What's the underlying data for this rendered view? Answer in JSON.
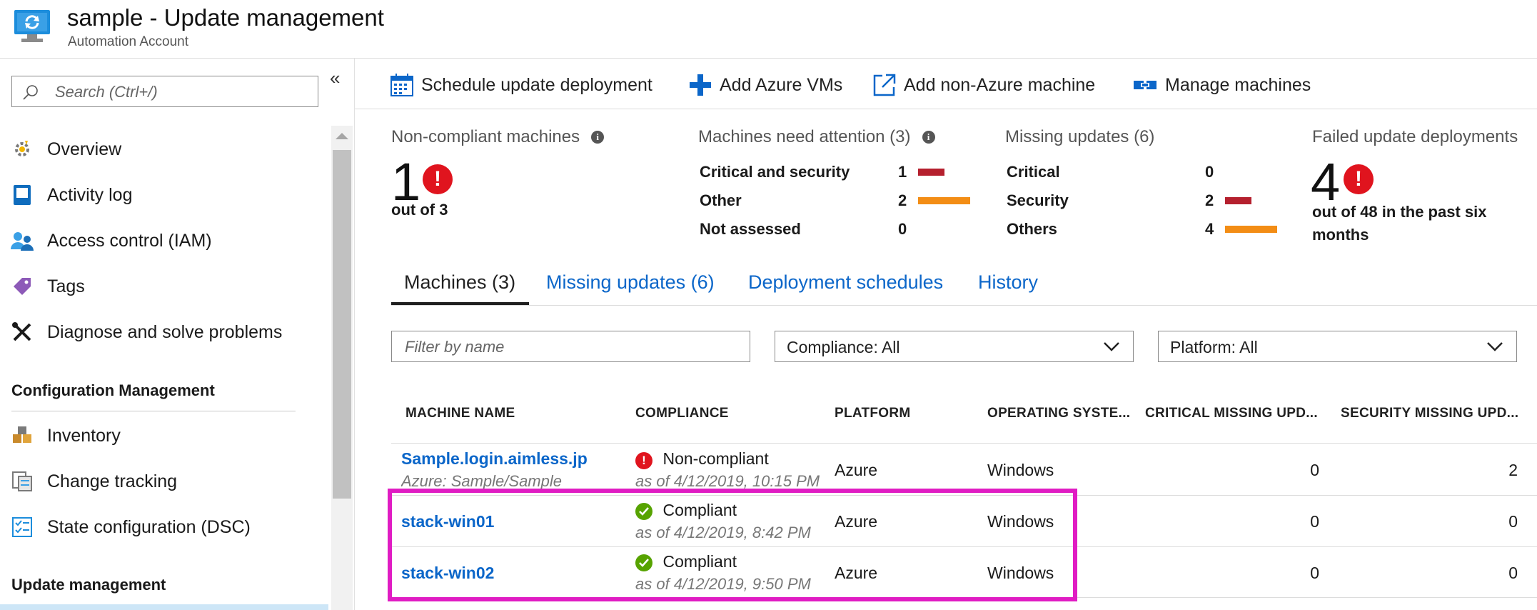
{
  "header": {
    "title": "sample - Update management",
    "subtitle": "Automation Account",
    "icon": "automation-account-icon"
  },
  "sidebar": {
    "search_placeholder": "Search (Ctrl+/)",
    "collapse_glyph": "«",
    "items": [
      {
        "label": "Overview",
        "icon": "overview-icon"
      },
      {
        "label": "Activity log",
        "icon": "activity-log-icon"
      },
      {
        "label": "Access control (IAM)",
        "icon": "iam-icon"
      },
      {
        "label": "Tags",
        "icon": "tag-icon"
      },
      {
        "label": "Diagnose and solve problems",
        "icon": "wrench-icon"
      }
    ],
    "sections": [
      {
        "title": "Configuration Management",
        "items": [
          {
            "label": "Inventory",
            "icon": "inventory-icon"
          },
          {
            "label": "Change tracking",
            "icon": "change-tracking-icon"
          },
          {
            "label": "State configuration (DSC)",
            "icon": "dsc-icon"
          }
        ]
      },
      {
        "title": "Update management",
        "items": []
      }
    ]
  },
  "toolbar": {
    "schedule": "Schedule update deployment",
    "add_azure": "Add Azure VMs",
    "add_non_azure": "Add non-Azure machine",
    "manage": "Manage machines"
  },
  "summary": {
    "noncompliant": {
      "title": "Non-compliant machines",
      "value": "1",
      "caption": "out of 3"
    },
    "attention": {
      "title": "Machines need attention (3)",
      "rows": [
        {
          "label": "Critical and security",
          "value": "1",
          "bar": "red",
          "bar_fraction": 0.5
        },
        {
          "label": "Other",
          "value": "2",
          "bar": "orange",
          "bar_fraction": 1.0
        },
        {
          "label": "Not assessed",
          "value": "0",
          "bar": "none",
          "bar_fraction": 0
        }
      ]
    },
    "missing": {
      "title": "Missing updates (6)",
      "rows": [
        {
          "label": "Critical",
          "value": "0",
          "bar": "none",
          "bar_fraction": 0
        },
        {
          "label": "Security",
          "value": "2",
          "bar": "red",
          "bar_fraction": 0.5
        },
        {
          "label": "Others",
          "value": "4",
          "bar": "orange",
          "bar_fraction": 1.0
        }
      ]
    },
    "failed": {
      "title": "Failed update deployments",
      "value": "4",
      "caption": "out of 48 in the past six months"
    }
  },
  "tabs": [
    "Machines (3)",
    "Missing updates (6)",
    "Deployment schedules",
    "History"
  ],
  "filters": {
    "name_placeholder": "Filter by name",
    "compliance": "Compliance: All",
    "platform": "Platform: All"
  },
  "table": {
    "columns": [
      "MACHINE NAME",
      "COMPLIANCE",
      "PLATFORM",
      "OPERATING SYSTE...",
      "CRITICAL MISSING UPD...",
      "SECURITY MISSING UPD..."
    ],
    "rows": [
      {
        "name": "Sample.login.aimless.jp",
        "sub": "Azure: Sample/Sample",
        "status": "Non-compliant",
        "status_kind": "error",
        "as_of": "as of 4/12/2019, 10:15 PM",
        "platform": "Azure",
        "os": "Windows",
        "critical": "0",
        "security": "2"
      },
      {
        "name": "stack-win01",
        "sub": "",
        "status": "Compliant",
        "status_kind": "ok",
        "as_of": "as of 4/12/2019, 8:42 PM",
        "platform": "Azure",
        "os": "Windows",
        "critical": "0",
        "security": "0"
      },
      {
        "name": "stack-win02",
        "sub": "",
        "status": "Compliant",
        "status_kind": "ok",
        "as_of": "as of 4/12/2019, 9:50 PM",
        "platform": "Azure",
        "os": "Windows",
        "critical": "0",
        "security": "0"
      }
    ]
  },
  "colors": {
    "link": "#0b66c9",
    "error": "#e0141e",
    "ok": "#57a300",
    "bar_red": "#b5202e",
    "bar_orange": "#f38d15",
    "highlight": "#e01cc3"
  }
}
